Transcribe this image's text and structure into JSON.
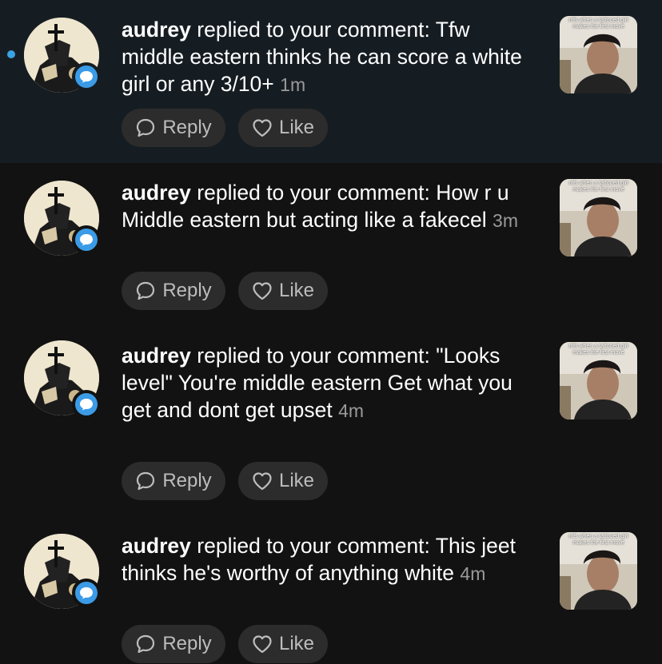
{
  "notifications": [
    {
      "unread": true,
      "username": "audrey",
      "message": "replied to your comment: Tfw middle eastern thinks he can score a white girl or any 3/10+",
      "time": "1m",
      "reply_label": "Reply",
      "like_label": "Like",
      "thumbnail_caption": "mfs when a tattooed girl makes the first move"
    },
    {
      "unread": false,
      "username": "audrey",
      "message": "replied to your comment: How r u Middle eastern but acting like a fakecel",
      "time": "3m",
      "reply_label": "Reply",
      "like_label": "Like",
      "thumbnail_caption": "mfs when a tattooed girl makes the first move"
    },
    {
      "unread": false,
      "username": "audrey",
      "message": "replied to your comment: \"Looks level\" You're middle eastern Get what you get and dont get upset",
      "time": "4m",
      "reply_label": "Reply",
      "like_label": "Like",
      "thumbnail_caption": "mfs when a tattooed girl makes the first move"
    },
    {
      "unread": false,
      "username": "audrey",
      "message": "replied to your comment: This jeet thinks he's worthy of anything white",
      "time": "4m",
      "reply_label": "Reply",
      "like_label": "Like",
      "thumbnail_caption": "mfs when a tattooed girl makes the first move"
    }
  ],
  "colors": {
    "background": "#121212",
    "unread_background": "#161d22",
    "accent": "#3b9be6",
    "button_bg": "#2c2c2c",
    "timestamp": "#9a9a9a"
  },
  "icons": {
    "reply": "speech-bubble-icon",
    "like": "heart-icon",
    "badge": "comment-badge-icon",
    "unread": "unread-dot-icon"
  }
}
